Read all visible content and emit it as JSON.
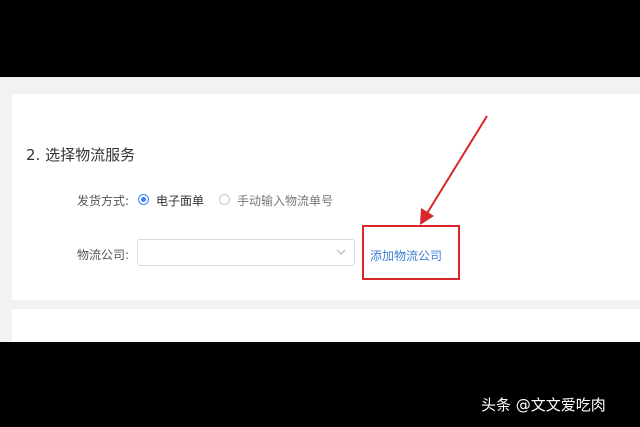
{
  "section": {
    "title": "2. 选择物流服务"
  },
  "shipping": {
    "label": "发货方式:",
    "options": [
      {
        "label": "电子面单",
        "checked": true
      },
      {
        "label": "手动输入物流单号",
        "checked": false
      }
    ]
  },
  "company": {
    "label": "物流公司:",
    "selected_value": "",
    "add_link": "添加物流公司"
  },
  "colors": {
    "accent": "#3b82f6",
    "link": "#3d7fd6",
    "annotation": "#d9262b"
  },
  "watermark": {
    "text": "头条 @文文爱吃肉"
  }
}
